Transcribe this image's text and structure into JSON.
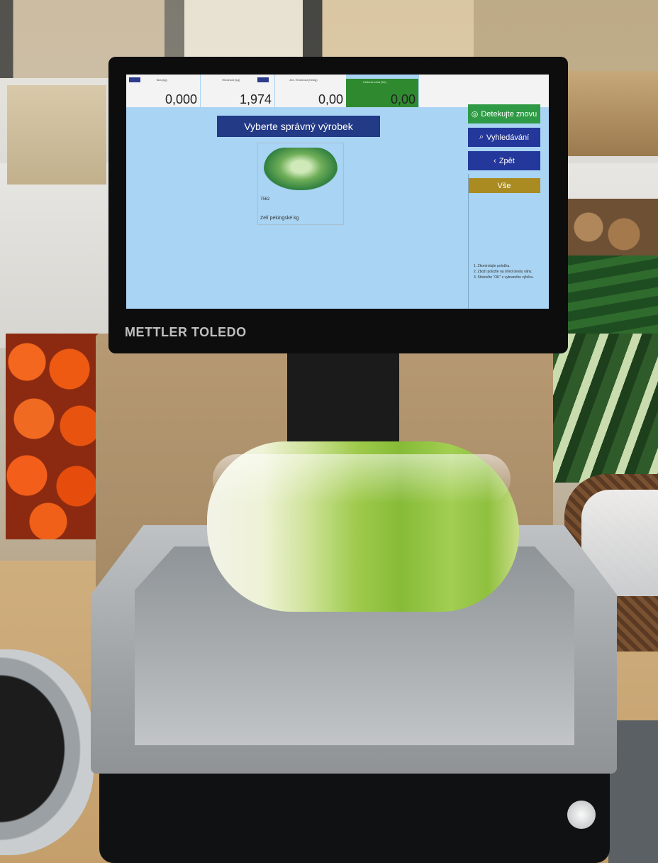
{
  "scene": "store-weighing-scale",
  "brand": "METTLER TOLEDO",
  "screen": {
    "header": {
      "tare_label": "Tara (kg)",
      "tare_value": "0,000",
      "weight_label": "Hmotnost (kg)",
      "weight_value": "1,974",
      "price_label": "Jed. Hmotnost (Kč/kg)",
      "price_value": "0,00",
      "total_label": "Celková cena (Kč)",
      "total_value": "0,00"
    },
    "title": "Vyberte správný výrobek",
    "product": {
      "plu": "7562",
      "name": "Zelí pekingské kg"
    },
    "buttons": {
      "detect": "Detekujte znovu",
      "search": "Vyhledávání",
      "back": "Zpět",
      "all": "Vše"
    },
    "instructions": [
      "1. Zkontrolujte položku.",
      "2. Zboží položte na střed desky váhy.",
      "3. Stiskněte \"OK\" z vybraného výběru."
    ]
  },
  "colors": {
    "screen_bg": "#a9d4f3",
    "title_bar": "#233a86",
    "detect_btn": "#2f9a45",
    "search_btn": "#24379a",
    "all_btn": "#a98b22",
    "total_green": "#2f8a2f"
  }
}
